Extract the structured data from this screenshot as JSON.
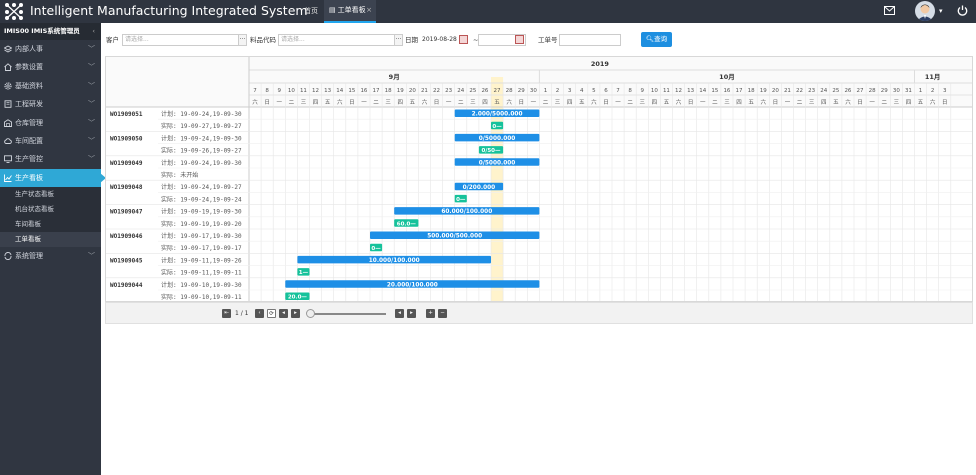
{
  "header": {
    "title": "Intelligent Manufacturing Integrated System",
    "tabs": [
      {
        "label": "首页"
      },
      {
        "label": "工单看板",
        "close": "×"
      }
    ]
  },
  "sidebar": {
    "system_name": "IMIS00 IMIS系统管理员",
    "collapse": "‹",
    "items": [
      {
        "label": "内部人事",
        "icon": "stack-icon"
      },
      {
        "label": "参数设置",
        "icon": "home-icon"
      },
      {
        "label": "基础资料",
        "icon": "gear-icon"
      },
      {
        "label": "工程研发",
        "icon": "book-icon"
      },
      {
        "label": "仓库管理",
        "icon": "warehouse-icon"
      },
      {
        "label": "车间配置",
        "icon": "cloud-icon"
      },
      {
        "label": "生产管控",
        "icon": "monitor-icon"
      },
      {
        "label": "生产看板",
        "icon": "chart-icon",
        "active": true
      },
      {
        "label": "系统管理",
        "icon": "cycle-icon"
      }
    ],
    "subitems": [
      {
        "label": "生产状态看板"
      },
      {
        "label": "机台状态看板"
      },
      {
        "label": "车间看板"
      },
      {
        "label": "工单看板",
        "current": true
      }
    ]
  },
  "filter": {
    "customer_label": "客户",
    "customer_placeholder": "请选择...",
    "material_label": "料品代码",
    "material_placeholder": "请选择...",
    "date_label": "日期",
    "date_from": "2019-08-28",
    "date_sep": "~",
    "order_label": "工单号",
    "query": "查询",
    "dots": "···"
  },
  "gantt": {
    "year": "2019",
    "months": [
      {
        "label": "9月",
        "start": 0
      },
      {
        "label": "10月",
        "start": 24
      },
      {
        "label": "11月",
        "start": 55
      }
    ],
    "days": [
      "7",
      "8",
      "9",
      "10",
      "11",
      "12",
      "13",
      "14",
      "15",
      "16",
      "17",
      "18",
      "19",
      "20",
      "21",
      "22",
      "23",
      "24",
      "25",
      "26",
      "27",
      "28",
      "29",
      "30",
      "1",
      "2",
      "3",
      "4",
      "5",
      "6",
      "7",
      "8",
      "9",
      "10",
      "11",
      "12",
      "13",
      "14",
      "15",
      "16",
      "17",
      "18",
      "19",
      "20",
      "21",
      "22",
      "23",
      "24",
      "25",
      "26",
      "27",
      "28",
      "29",
      "30",
      "31",
      "1",
      "2",
      "3"
    ],
    "weekdays": [
      "六",
      "日",
      "一",
      "二",
      "三",
      "四",
      "五",
      "六",
      "日",
      "一",
      "二",
      "三",
      "四",
      "五",
      "六",
      "日",
      "一",
      "二",
      "三",
      "四",
      "五",
      "六",
      "日",
      "一",
      "二",
      "三",
      "四",
      "五",
      "六",
      "日",
      "一",
      "二",
      "三",
      "四",
      "五",
      "六",
      "日",
      "一",
      "二",
      "三",
      "四",
      "五",
      "六",
      "日",
      "一",
      "二",
      "三",
      "四",
      "五",
      "六",
      "日",
      "一",
      "二",
      "三",
      "四",
      "五",
      "六",
      "日"
    ],
    "today_index": 20,
    "rows": [
      {
        "order": "WO1909051",
        "plan": "计划: 19-09-24,19-09-30",
        "actual": "实际: 19-09-27,19-09-27",
        "plan_span": [
          17,
          23
        ],
        "plan_label": "2.000/5000.000",
        "actual_span": [
          20,
          20
        ],
        "actual_label": "0—"
      },
      {
        "order": "WO1909050",
        "plan": "计划: 19-09-24,19-09-30",
        "actual": "实际: 19-09-26,19-09-27",
        "plan_span": [
          17,
          23
        ],
        "plan_label": "0/5000.000",
        "actual_span": [
          19,
          20
        ],
        "actual_label": "0/50—"
      },
      {
        "order": "WO1909049",
        "plan": "计划: 19-09-24,19-09-30",
        "actual": "实际: 未开始",
        "plan_span": [
          17,
          23
        ],
        "plan_label": "0/5000.000",
        "actual_span": null,
        "actual_label": ""
      },
      {
        "order": "WO1909048",
        "plan": "计划: 19-09-24,19-09-27",
        "actual": "实际: 19-09-24,19-09-24",
        "plan_span": [
          17,
          20
        ],
        "plan_label": "0/200.000",
        "actual_span": [
          17,
          17
        ],
        "actual_label": "0—"
      },
      {
        "order": "WO1909047",
        "plan": "计划: 19-09-19,19-09-30",
        "actual": "实际: 19-09-19,19-09-20",
        "plan_span": [
          12,
          23
        ],
        "plan_label": "60.000/100.000",
        "actual_span": [
          12,
          13
        ],
        "actual_label": "60.0—"
      },
      {
        "order": "WO1909046",
        "plan": "计划: 19-09-17,19-09-30",
        "actual": "实际: 19-09-17,19-09-17",
        "plan_span": [
          10,
          23
        ],
        "plan_label": "500.000/500.000",
        "actual_span": [
          10,
          10
        ],
        "actual_label": "0—"
      },
      {
        "order": "WO1909045",
        "plan": "计划: 19-09-11,19-09-26",
        "actual": "实际: 19-09-11,19-09-11",
        "plan_span": [
          4,
          19
        ],
        "plan_label": "10.000/100.000",
        "actual_span": [
          4,
          4
        ],
        "actual_label": "1—"
      },
      {
        "order": "WO1909044",
        "plan": "计划: 19-09-10,19-09-30",
        "actual": "实际: 19-09-10,19-09-11",
        "plan_span": [
          3,
          23
        ],
        "plan_label": "20.000/100.000",
        "actual_span": [
          3,
          4
        ],
        "actual_label": "20.0—"
      }
    ]
  },
  "pager": {
    "page": "1 / 1"
  },
  "colors": {
    "plan_bar": "#1e8fe6",
    "actual_bar": "#16c29b",
    "today": "#fff3cc",
    "sidebar_active": "#2fa8d6"
  }
}
